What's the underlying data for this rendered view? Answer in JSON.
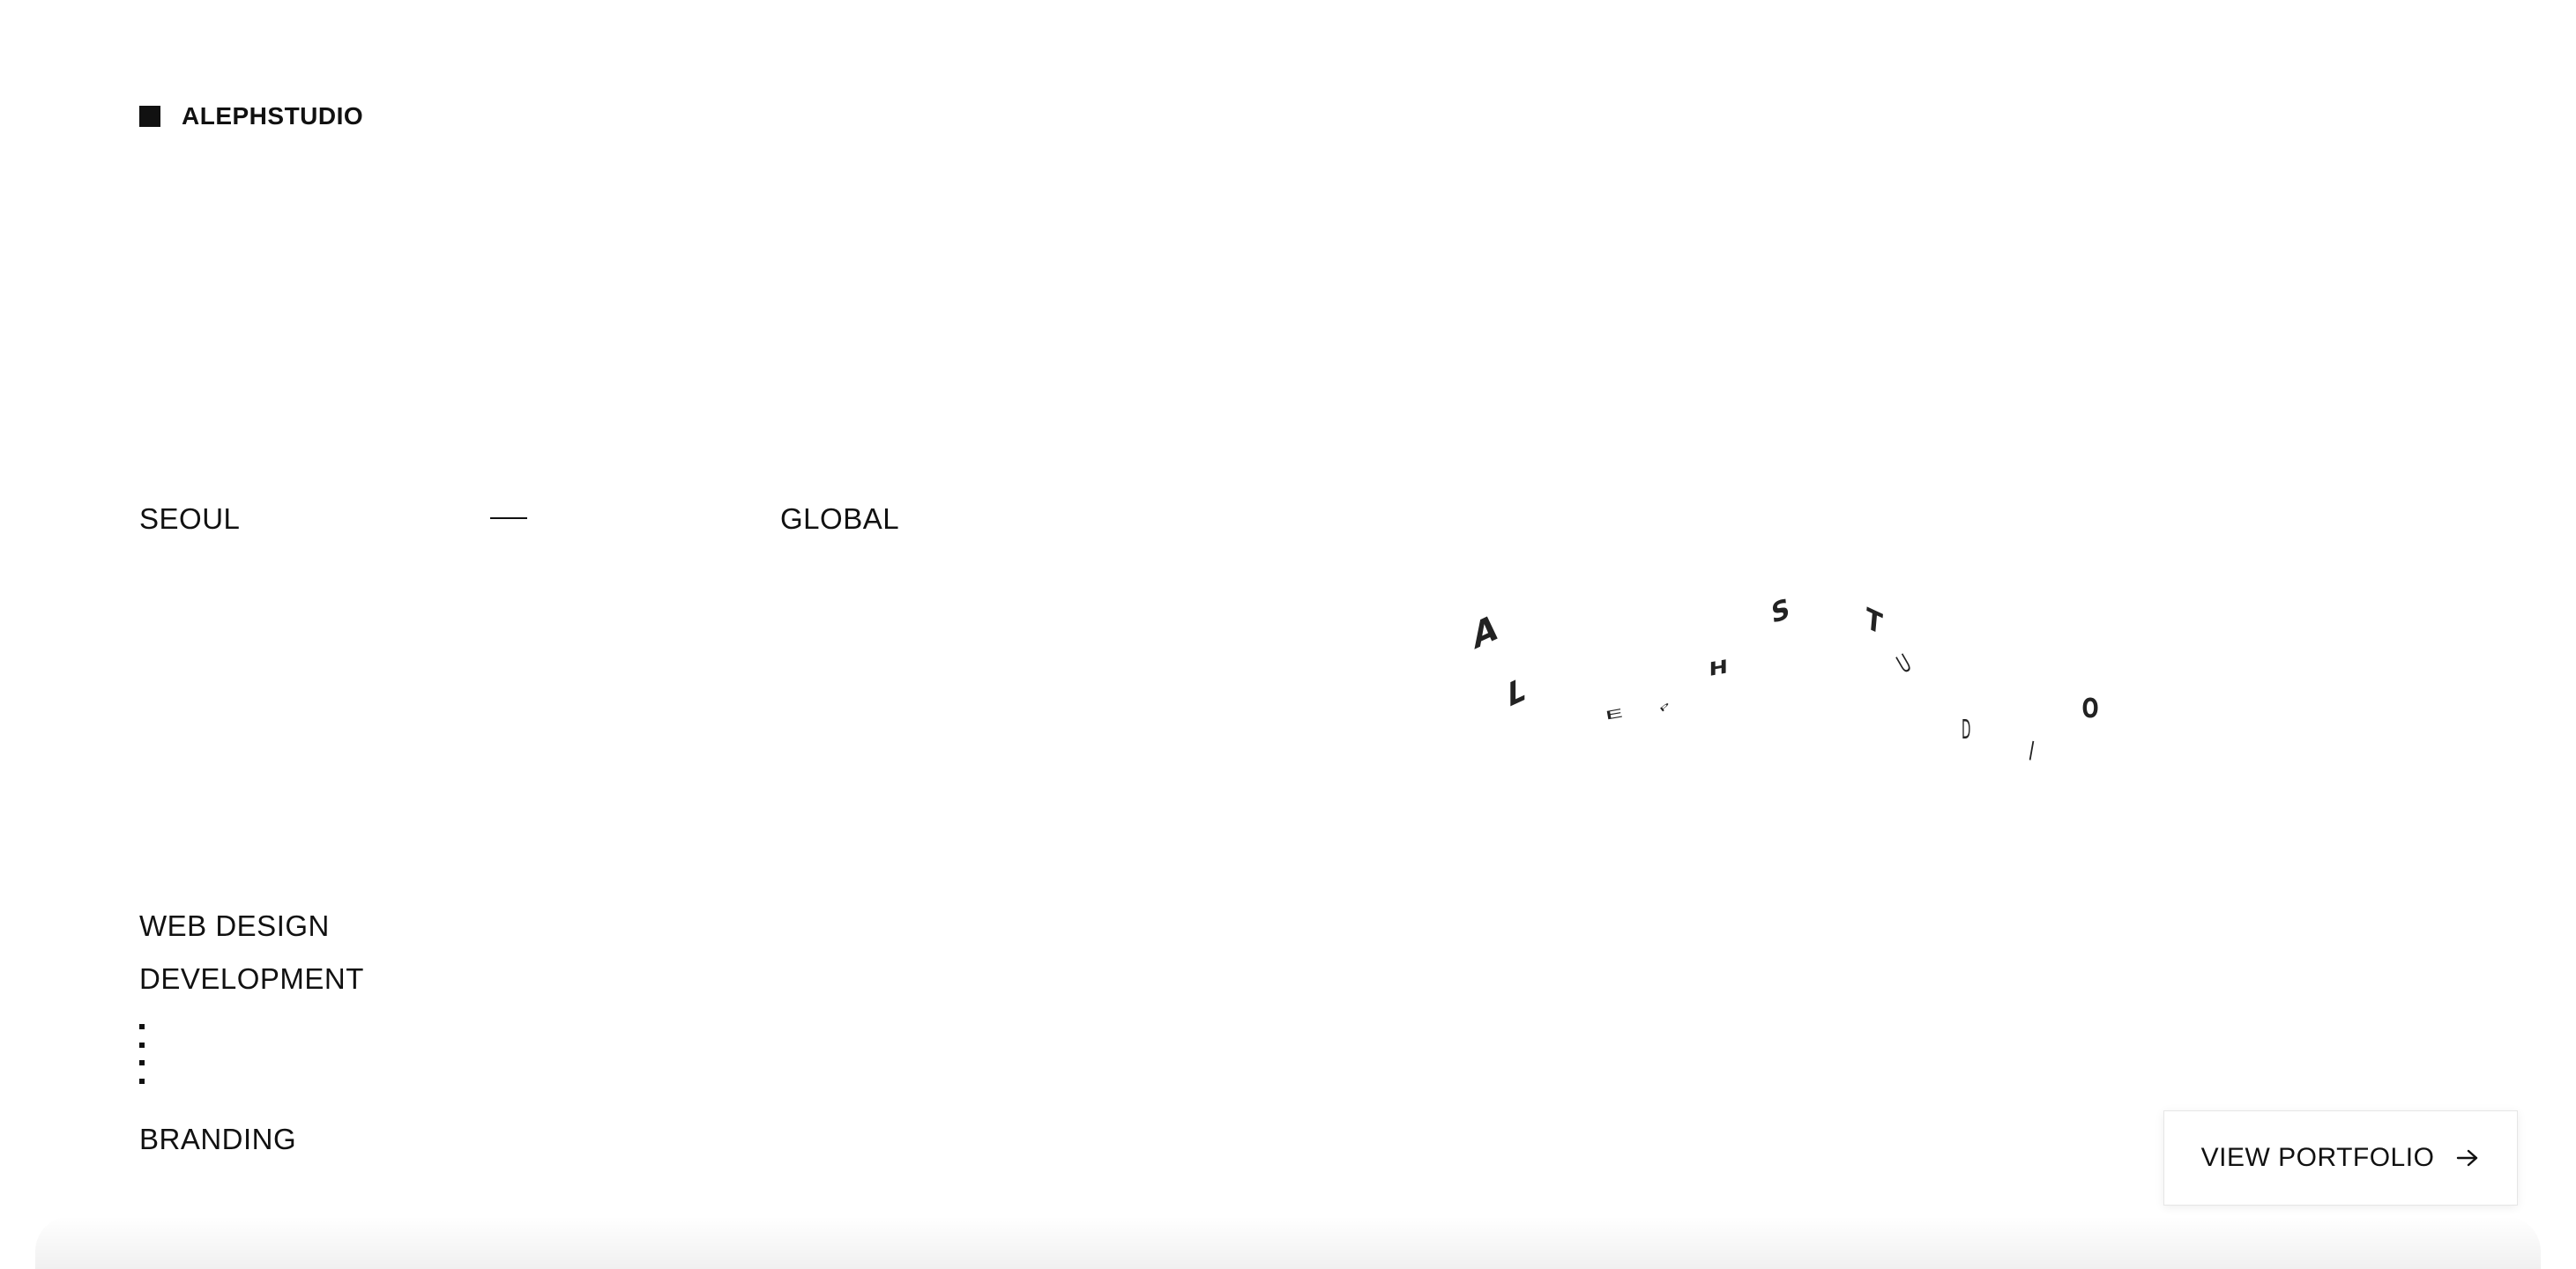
{
  "brand": {
    "name": "ALEPHSTUDIO"
  },
  "location": {
    "from": "SEOUL",
    "to": "GLOBAL"
  },
  "services": {
    "items": [
      "WEB DESIGN",
      "DEVELOPMENT",
      "BRANDING"
    ]
  },
  "wave_letters": [
    "A",
    "L",
    "E",
    "P",
    "H",
    "S",
    "T",
    "U",
    "D",
    "I",
    "O"
  ],
  "cta": {
    "label": "VIEW PORTFOLIO",
    "icon": "arrow-right-icon"
  },
  "colors": {
    "text": "#111111",
    "background": "#ffffff"
  }
}
